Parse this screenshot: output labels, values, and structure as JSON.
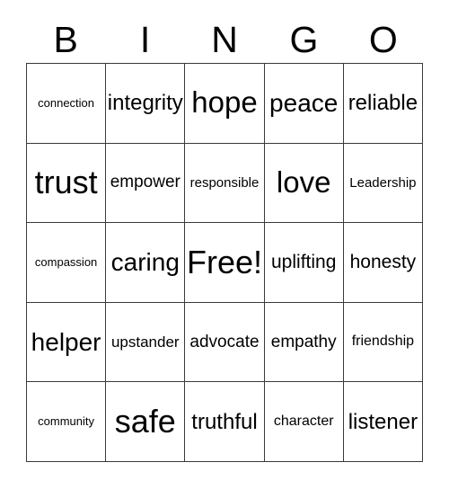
{
  "card": {
    "title": "BINGO",
    "headers": [
      "B",
      "I",
      "N",
      "G",
      "O"
    ],
    "grid_line_color": "#3a3a3a",
    "background_color": "#ffffff",
    "text_color": "#000000",
    "rows": [
      [
        {
          "label": "connection",
          "size": "xs"
        },
        {
          "label": "integrity",
          "size": "xl"
        },
        {
          "label": "hope",
          "size": "h"
        },
        {
          "label": "peace",
          "size": "xxl"
        },
        {
          "label": "reliable",
          "size": "xl"
        }
      ],
      [
        {
          "label": "trust",
          "size": "hh"
        },
        {
          "label": "empower",
          "size": "ml"
        },
        {
          "label": "responsible",
          "size": "s"
        },
        {
          "label": "love",
          "size": "h"
        },
        {
          "label": "Leadership",
          "size": "s"
        }
      ],
      [
        {
          "label": "compassion",
          "size": "xs"
        },
        {
          "label": "caring",
          "size": "xxl"
        },
        {
          "label": "Free!",
          "size": "hh"
        },
        {
          "label": "uplifting",
          "size": "l"
        },
        {
          "label": "honesty",
          "size": "l"
        }
      ],
      [
        {
          "label": "helper",
          "size": "xxl"
        },
        {
          "label": "upstander",
          "size": "m"
        },
        {
          "label": "advocate",
          "size": "ml"
        },
        {
          "label": "empathy",
          "size": "ml"
        },
        {
          "label": "friendship",
          "size": "sm"
        }
      ],
      [
        {
          "label": "community",
          "size": "xs"
        },
        {
          "label": "safe",
          "size": "hh"
        },
        {
          "label": "truthful",
          "size": "xl"
        },
        {
          "label": "character",
          "size": "sm"
        },
        {
          "label": "listener",
          "size": "xl"
        }
      ]
    ]
  }
}
